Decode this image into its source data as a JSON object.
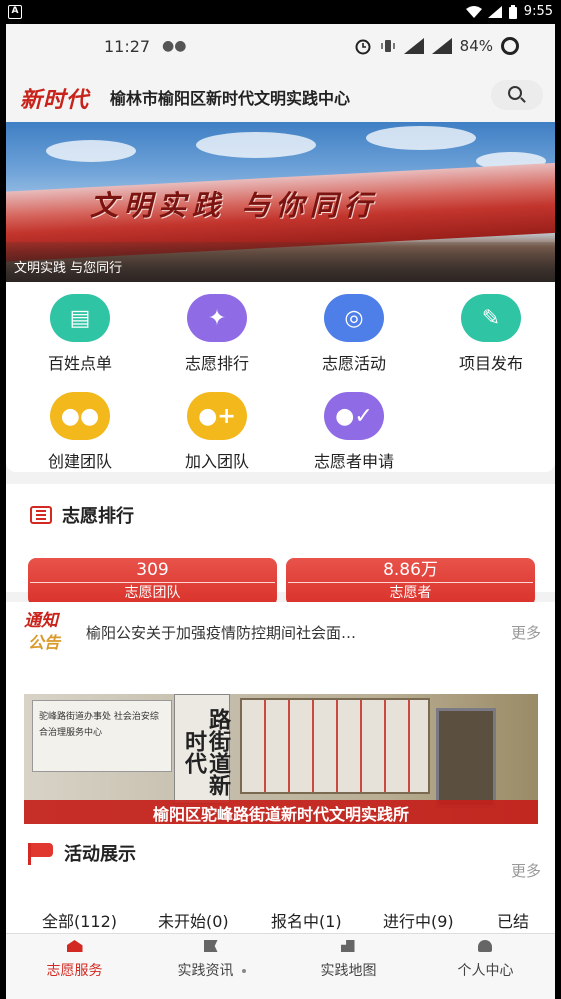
{
  "system_bar": {
    "badge": "A",
    "time": "9:55"
  },
  "phone_status": {
    "time": "11:27",
    "battery": "84%"
  },
  "header": {
    "logo": "新时代",
    "title": "榆林市榆阳区新时代文明实践中心"
  },
  "banner": {
    "slogan": "文明实践  与你同行",
    "caption": "文明实践 与您同行"
  },
  "grid": [
    {
      "label": "百姓点单",
      "color": "#2ec4a4",
      "icon": "clipboard-check-icon"
    },
    {
      "label": "志愿排行",
      "color": "#8f6be6",
      "icon": "handshake-icon"
    },
    {
      "label": "志愿活动",
      "color": "#4e7ee8",
      "icon": "people-circle-icon"
    },
    {
      "label": "项目发布",
      "color": "#2ec4a4",
      "icon": "document-edit-icon"
    },
    {
      "label": "创建团队",
      "color": "#f2b81c",
      "icon": "group-icon"
    },
    {
      "label": "加入团队",
      "color": "#f2b81c",
      "icon": "join-group-icon"
    },
    {
      "label": "志愿者申请",
      "color": "#8f6be6",
      "icon": "user-apply-icon"
    }
  ],
  "ranking": {
    "title": "志愿排行",
    "stats": [
      {
        "value": "309",
        "label": "志愿团队"
      },
      {
        "value": "8.86万",
        "label": "志愿者"
      }
    ]
  },
  "notice": {
    "tag_line1": "通知",
    "tag_line2": "公告",
    "text": "榆阳公安关于加强疫情防控期间社会面…",
    "more": "更多"
  },
  "feature": {
    "plate": "驼峰路街道办事处 社会治安综合治理服务中心",
    "vertical_sign": "路街道新时代",
    "caption": "榆阳区驼峰路街道新时代文明实践所"
  },
  "activity": {
    "title": "活动展示",
    "more": "更多",
    "tabs": [
      "全部(112)",
      "未开始(0)",
      "报名中(1)",
      "进行中(9)",
      "已结"
    ]
  },
  "bottom_nav": [
    {
      "label": "志愿服务",
      "icon": "home-icon"
    },
    {
      "label": "实践资讯",
      "icon": "flag-icon"
    },
    {
      "label": "实践地图",
      "icon": "building-icon"
    },
    {
      "label": "个人中心",
      "icon": "person-icon"
    }
  ]
}
